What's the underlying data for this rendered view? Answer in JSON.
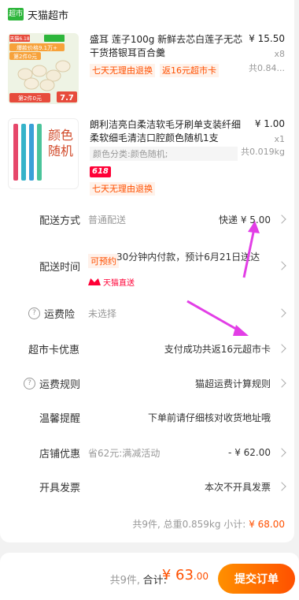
{
  "store": {
    "logo_text": "超市",
    "name": "天猫超市"
  },
  "items": [
    {
      "title": "盛耳 莲子100g 新鲜去芯白莲子无芯干货搭银耳百合羹",
      "price": "¥ 15.50",
      "qty": "x8",
      "weight": "共0.84...",
      "tags": [
        "七天无理由退换",
        "返16元超市卡"
      ],
      "thumb": {
        "top_badge": "天猫6.18",
        "banner": "爆款价格9.1万+",
        "line2": "第2件0元",
        "footer": "第2件0元",
        "price_tag": "7.7"
      }
    },
    {
      "title": "朗利洁亮白柔洁软毛牙刷单支装纤细柔软细毛清洁口腔颜色随机1支",
      "price": "¥ 1.00",
      "qty": "x1",
      "weight": "共0.019kg",
      "sku": "颜色分类:颜色随机;",
      "badge": "618",
      "tags": [
        "七天无理由退换"
      ],
      "thumb": {
        "text": "颜色随机"
      }
    }
  ],
  "rows": {
    "delivery": {
      "label": "配送方式",
      "sub": "普通配送",
      "value": "快递 ¥ 5.00"
    },
    "delivery_time": {
      "label": "配送时间",
      "badge": "可预约",
      "text": "30分钟内付款，预计6月21日送达",
      "direct": "天猫直送"
    },
    "insurance": {
      "label": "运费险",
      "sub": "未选择"
    },
    "market_card": {
      "label": "超市卡优惠",
      "value": "支付成功共返16元超市卡"
    },
    "freight_rule": {
      "label": "运费规则",
      "value": "猫超运费计算规则"
    },
    "reminder": {
      "label": "温馨提醒",
      "value": "下单前请仔细核对收货地址哦"
    },
    "store_discount": {
      "label": "店铺优惠",
      "sub": "省62元:满减活动",
      "value": "- ¥ 62.00"
    },
    "invoice": {
      "label": "开具发票",
      "value": "本次不开具发票"
    }
  },
  "summary": {
    "text": "共9件, 总重0.859kg 小计:",
    "amount": "¥ 68.00"
  },
  "bottom": {
    "count": "共9件,",
    "total_label": "合计:",
    "total_int": "¥ 63",
    "total_dec": ".00",
    "submit": "提交订单"
  },
  "colors": {
    "accent": "#ff5000",
    "annotation_arrow": "#e23ee6"
  }
}
